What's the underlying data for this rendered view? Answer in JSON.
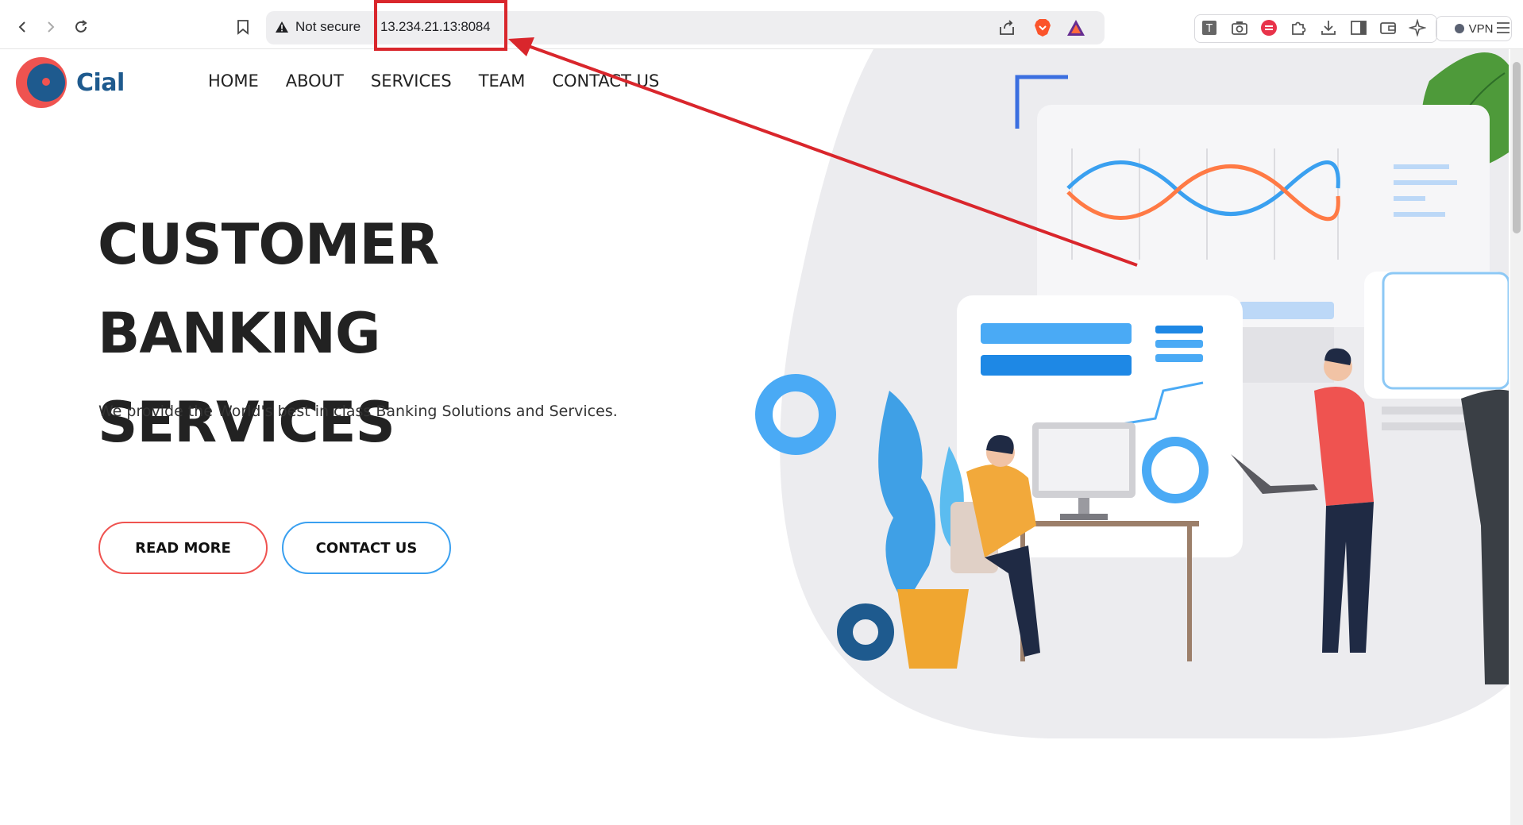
{
  "browser": {
    "security_label": "Not secure",
    "url": "13.234.21.13:8084",
    "vpn_label": "VPN"
  },
  "site": {
    "logo_text": "Cial",
    "nav": [
      "HOME",
      "ABOUT",
      "SERVICES",
      "TEAM",
      "CONTACT US"
    ],
    "hero": {
      "title_line1": "CUSTOMER BANKING",
      "title_line2": "SERVICES",
      "subtitle": "We provide the World's best in class Banking Solutions and Services.",
      "read_more": "READ MORE",
      "contact_us": "CONTACT US"
    }
  },
  "colors": {
    "accent_red": "#ef5350",
    "accent_blue": "#3aa0f0",
    "brand_navy": "#1e5a8e",
    "annotation": "#d9262c"
  },
  "icons": [
    "back-arrow-icon",
    "forward-arrow-icon",
    "reload-icon",
    "bookmark-icon",
    "warning-icon",
    "share-icon",
    "brave-lion-icon",
    "rewards-triangle-icon",
    "extension-icons",
    "vpn-icon"
  ]
}
